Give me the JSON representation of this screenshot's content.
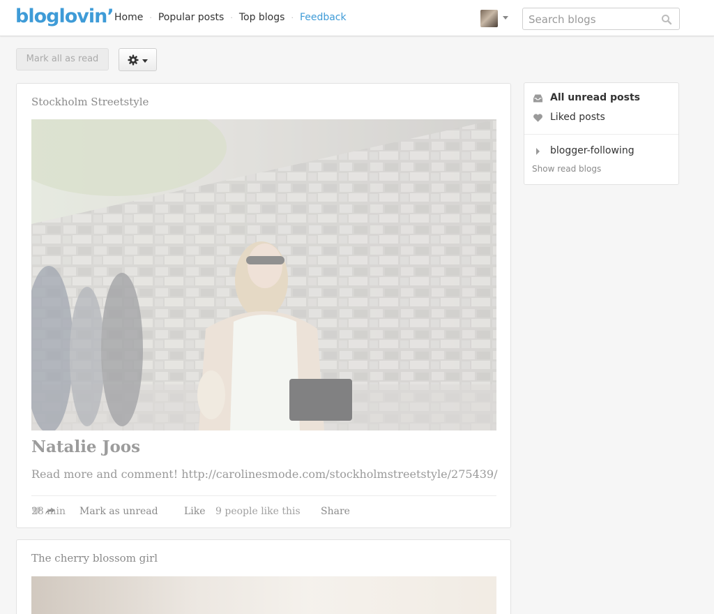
{
  "header": {
    "logo": "bloglovin’",
    "nav": [
      {
        "label": "Home"
      },
      {
        "label": "Popular posts"
      },
      {
        "label": "Top blogs"
      },
      {
        "label": "Feedback"
      }
    ],
    "search_placeholder": "Search blogs"
  },
  "toolbar": {
    "mark_all_label": "Mark all as read"
  },
  "posts": [
    {
      "blog": "Stockholm Streetstyle",
      "title": "Natalie Joos",
      "text": "Read more and comment! http://carolinesmode.com/stockholmstreetstyle/275439/",
      "time": "28 min",
      "mark_unread": "Mark as unread",
      "like": "Like",
      "like_count": "9 people like this",
      "share": "Share"
    },
    {
      "blog": "The cherry blossom girl"
    }
  ],
  "sidebar": {
    "all_unread": "All unread posts",
    "liked": "Liked posts",
    "following": "blogger-following",
    "show_read": "Show read blogs"
  },
  "colors": {
    "accent": "#3e9bd7",
    "background": "#f6f6f6",
    "faded_text": "#9a9a9a"
  }
}
